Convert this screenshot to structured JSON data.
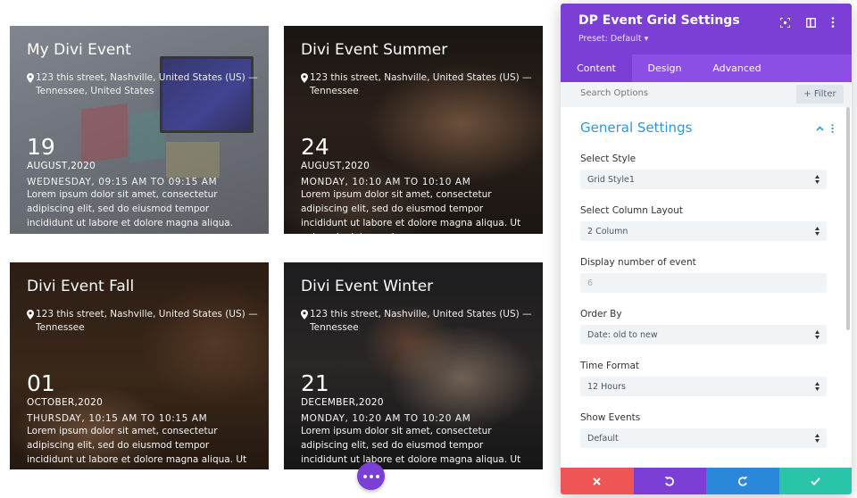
{
  "events": [
    {
      "title": "My Divi Event",
      "location": "123 this street, Nashville, United States (US) — Tennessee, United States",
      "day": "19",
      "month_year": "AUGUST,2020",
      "time": "WEDNESDAY, 09:15 AM TO 09:15 AM",
      "description": "Lorem ipsum dolor sit amet, consectetur adipiscing elit, sed do eiusmod tempor incididunt ut labore et dolore magna aliqua."
    },
    {
      "title": "Divi Event Summer",
      "location": "123 this street, Nashville, United States (US) — Tennessee",
      "day": "24",
      "month_year": "AUGUST,2020",
      "time": "MONDAY, 10:10 AM TO 10:10 AM",
      "description": "Lorem ipsum dolor sit amet, consectetur adipiscing elit, sed do eiusmod tempor incididunt ut labore et dolore magna aliqua. Ut enim ad minim veniam,"
    },
    {
      "title": "Divi Event Fall",
      "location": "123 this street, Nashville, United States (US) — Tennessee",
      "day": "01",
      "month_year": "OCTOBER,2020",
      "time": "THURSDAY, 10:15 AM TO 10:15 AM",
      "description": "Lorem ipsum dolor sit amet, consectetur adipiscing elit, sed do eiusmod tempor incididunt ut labore et dolore magna aliqua. Ut enim ad minim veniam,"
    },
    {
      "title": "Divi Event Winter",
      "location": "123 this street, Nashville, United States (US) — Tennessee",
      "day": "21",
      "month_year": "DECEMBER,2020",
      "time": "MONDAY, 10:20 AM TO 10:20 AM",
      "description": "Lorem ipsum dolor sit amet, consectetur adipiscing elit, sed do eiusmod tempor incididunt ut labore et dolore magna aliqua. Ut enim ad minim veniam,"
    }
  ],
  "panel": {
    "title": "DP Event Grid Settings",
    "preset": "Preset: Default ▾",
    "tabs": [
      "Content",
      "Design",
      "Advanced"
    ],
    "active_tab": "Content",
    "search_placeholder": "Search Options",
    "filter_label": "Filter",
    "section_title": "General Settings",
    "fields": [
      {
        "label": "Select Style",
        "value": "Grid Style1",
        "type": "select"
      },
      {
        "label": "Select Column Layout",
        "value": "2 Column",
        "type": "select"
      },
      {
        "label": "Display number of event",
        "value": "6",
        "type": "input"
      },
      {
        "label": "Order By",
        "value": "Date: old to new",
        "type": "select"
      },
      {
        "label": "Time Format",
        "value": "12 Hours",
        "type": "select"
      },
      {
        "label": "Show Events",
        "value": "Default",
        "type": "select"
      }
    ]
  },
  "colors": {
    "accent_purple": "#7b3fd6",
    "tab_bar": "#8b4fe6",
    "section_blue": "#2f96e0",
    "cancel": "#ef5555",
    "redo": "#2b87da",
    "save": "#29c4a9"
  },
  "icons": {
    "header": [
      "fullscreen-icon",
      "split-view-icon",
      "more-options-icon"
    ],
    "footer": [
      "close-icon",
      "undo-icon",
      "redo-icon",
      "check-icon"
    ],
    "card": "map-pin-icon",
    "floating": "more-dots-icon"
  }
}
